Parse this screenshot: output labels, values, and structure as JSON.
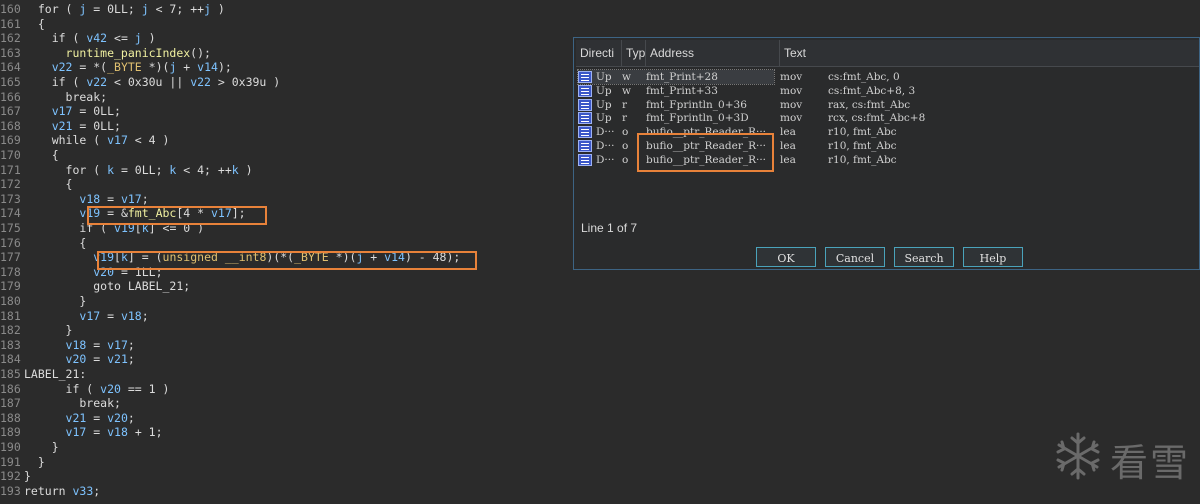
{
  "code_lines": [
    {
      "num": "160",
      "text": "  for ( j = 0LL; j < 7; ++j )"
    },
    {
      "num": "161",
      "text": "  {"
    },
    {
      "num": "162",
      "text": "    if ( v42 <= j )"
    },
    {
      "num": "163",
      "text": "      runtime_panicIndex();"
    },
    {
      "num": "164",
      "text": "    v22 = *(_BYTE *)(j + v14);"
    },
    {
      "num": "165",
      "text": "    if ( v22 < 0x30u || v22 > 0x39u )"
    },
    {
      "num": "166",
      "text": "      break;"
    },
    {
      "num": "167",
      "text": "    v17 = 0LL;"
    },
    {
      "num": "168",
      "text": "    v21 = 0LL;"
    },
    {
      "num": "169",
      "text": "    while ( v17 < 4 )"
    },
    {
      "num": "170",
      "text": "    {"
    },
    {
      "num": "171",
      "text": "      for ( k = 0LL; k < 4; ++k )"
    },
    {
      "num": "172",
      "text": "      {"
    },
    {
      "num": "173",
      "text": "        v18 = v17;"
    },
    {
      "num": "174",
      "text": "        v19 = &fmt_Abc[4 * v17];"
    },
    {
      "num": "175",
      "text": "        if ( v19[k] <= 0 )"
    },
    {
      "num": "176",
      "text": "        {"
    },
    {
      "num": "177",
      "text": "          v19[k] = (unsigned __int8)(*(_BYTE *)(j + v14) - 48);"
    },
    {
      "num": "178",
      "text": "          v20 = 1LL;"
    },
    {
      "num": "179",
      "text": "          goto LABEL_21;"
    },
    {
      "num": "180",
      "text": "        }"
    },
    {
      "num": "181",
      "text": "        v17 = v18;"
    },
    {
      "num": "182",
      "text": "      }"
    },
    {
      "num": "183",
      "text": "      v18 = v17;"
    },
    {
      "num": "184",
      "text": "      v20 = v21;"
    },
    {
      "num": "185",
      "text": "LABEL_21:"
    },
    {
      "num": "186",
      "text": "      if ( v20 == 1 )"
    },
    {
      "num": "187",
      "text": "        break;"
    },
    {
      "num": "188",
      "text": "      v21 = v20;"
    },
    {
      "num": "189",
      "text": "      v17 = v18 + 1;"
    },
    {
      "num": "190",
      "text": "    }"
    },
    {
      "num": "191",
      "text": "  }"
    },
    {
      "num": "192",
      "text": "}"
    },
    {
      "num": "193",
      "text": "return v33;"
    }
  ],
  "xrefs": {
    "columns": [
      "Directi",
      "Typ",
      "Address",
      "Text"
    ],
    "rows": [
      {
        "dir": "Up",
        "type": "w",
        "address": "fmt_Print+28",
        "mnemonic": "mov",
        "operands": "cs:fmt_Abc, 0"
      },
      {
        "dir": "Up",
        "type": "w",
        "address": "fmt_Print+33",
        "mnemonic": "mov",
        "operands": "cs:fmt_Abc+8, 3"
      },
      {
        "dir": "Up",
        "type": "r",
        "address": "fmt_Fprintln_0+36",
        "mnemonic": "mov",
        "operands": "rax, cs:fmt_Abc"
      },
      {
        "dir": "Up",
        "type": "r",
        "address": "fmt_Fprintln_0+3D",
        "mnemonic": "mov",
        "operands": "rcx, cs:fmt_Abc+8"
      },
      {
        "dir": "D···",
        "type": "o",
        "address": "bufio__ptr_Reader_R···",
        "mnemonic": "lea",
        "operands": "r10, fmt_Abc"
      },
      {
        "dir": "D···",
        "type": "o",
        "address": "bufio__ptr_Reader_R···",
        "mnemonic": "lea",
        "operands": "r10, fmt_Abc"
      },
      {
        "dir": "D···",
        "type": "o",
        "address": "bufio__ptr_Reader_R···",
        "mnemonic": "lea",
        "operands": "r10, fmt_Abc"
      }
    ],
    "status": "Line 1 of 7",
    "buttons": {
      "ok": "OK",
      "cancel": "Cancel",
      "search": "Search",
      "help": "Help"
    }
  },
  "colors": {
    "background": "#2b2b2b",
    "highlight_border": "#e8823a",
    "variable": "#7ec3ff",
    "function": "#f0f0a0",
    "type": "#e0c070",
    "number": "#e0e0e0",
    "line_number": "#8a8a8a"
  },
  "watermark": {
    "icon": "snowflake-icon",
    "text": "看雪"
  }
}
